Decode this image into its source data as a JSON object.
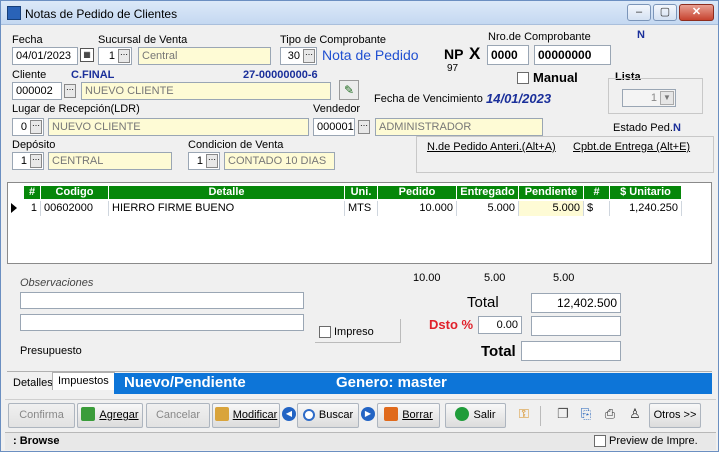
{
  "window": {
    "title": "Notas de Pedido de Clientes",
    "minimize": "‒",
    "maximize": "▢",
    "close": "✕",
    "corner_mark": "N"
  },
  "header": {
    "fecha_label": "Fecha",
    "fecha_value": "04/01/2023",
    "sucursal_label": "Sucursal de Venta",
    "sucursal_code": "1",
    "sucursal_name": "Central",
    "tipo_label": "Tipo de Comprobante",
    "tipo_code": "30",
    "tipo_name": "Nota de Pedido",
    "nro_label": "Nro.de Comprobante",
    "np_prefix": "NP",
    "letter": "X",
    "np_code": "97",
    "nro_punto": "0000",
    "nro_numero": "00000000",
    "manual_label": "Manual",
    "lista_label": "Lista",
    "lista_value": "1",
    "cliente_label": "Cliente",
    "cliente_tipo": "C.FINAL",
    "cliente_cuit": "27-00000000-6",
    "cliente_code": "000002",
    "cliente_name": "NUEVO CLIENTE",
    "fecha_venc_label": "Fecha de Vencimiento",
    "fecha_venc_value": "14/01/2023",
    "ldr_label": "Lugar de Recepción(LDR)",
    "ldr_code": "0",
    "ldr_name": "NUEVO CLIENTE",
    "vendedor_label": "Vendedor",
    "vendedor_code": "000001",
    "vendedor_name": "ADMINISTRADOR",
    "estado_label": "Estado Ped.:",
    "estado_value": "N",
    "deposito_label": "Depósito",
    "deposito_code": "1",
    "deposito_name": "CENTRAL",
    "condicion_label": "Condicion de Venta",
    "condicion_code": "1",
    "condicion_name": "CONTADO 10 DIAS",
    "link_pedido_anterior": "N.de Pedido Anteri.(Alt+A)",
    "link_cpbt_entrega": "Cpbt.de Entrega (Alt+E)"
  },
  "grid": {
    "columns": [
      "#",
      "Codigo",
      "Detalle",
      "Uni.",
      "Pedido",
      "Entregado",
      "Pendiente",
      "#",
      "$ Unitario"
    ],
    "rows": [
      {
        "num": "1",
        "codigo": "00602000",
        "detalle": "HIERRO FIRME BUENO",
        "uni": "MTS",
        "pedido": "10.000",
        "entregado": "5.000",
        "pendiente": "5.000",
        "moneda": "$",
        "unitario": "1,240.250"
      }
    ]
  },
  "totals_row": {
    "pedido": "10.00",
    "entregado": "5.00",
    "pendiente": "5.00"
  },
  "observaciones_label": "Observaciones",
  "impreso_label": "Impreso",
  "total_label": "Total",
  "total_value": "12,402.500",
  "dsto_label": "Dsto %",
  "dsto_value": "0.00",
  "total2_label": "Total",
  "presupuesto_label": "Presupuesto",
  "tabs": [
    "Detalles",
    "Impuestos"
  ],
  "status_bar_text": {
    "state": "Nuevo/Pendiente",
    "genero": "Genero: master"
  },
  "toolbar": {
    "confirma": "Confirma",
    "agregar": "Agregar",
    "cancelar": "Cancelar",
    "modificar": "Modificar",
    "buscar": "Buscar",
    "borrar": "Borrar",
    "salir": "Salir",
    "otros": "Otros >>"
  },
  "statusbar": {
    "mode": ": Browse",
    "preview_label": "Preview de Impre."
  },
  "colors": {
    "grid_header": "#06870a",
    "accent_blue": "#0d75d8",
    "red_label": "#e0202a",
    "field_yellow": "#fefbd5"
  }
}
